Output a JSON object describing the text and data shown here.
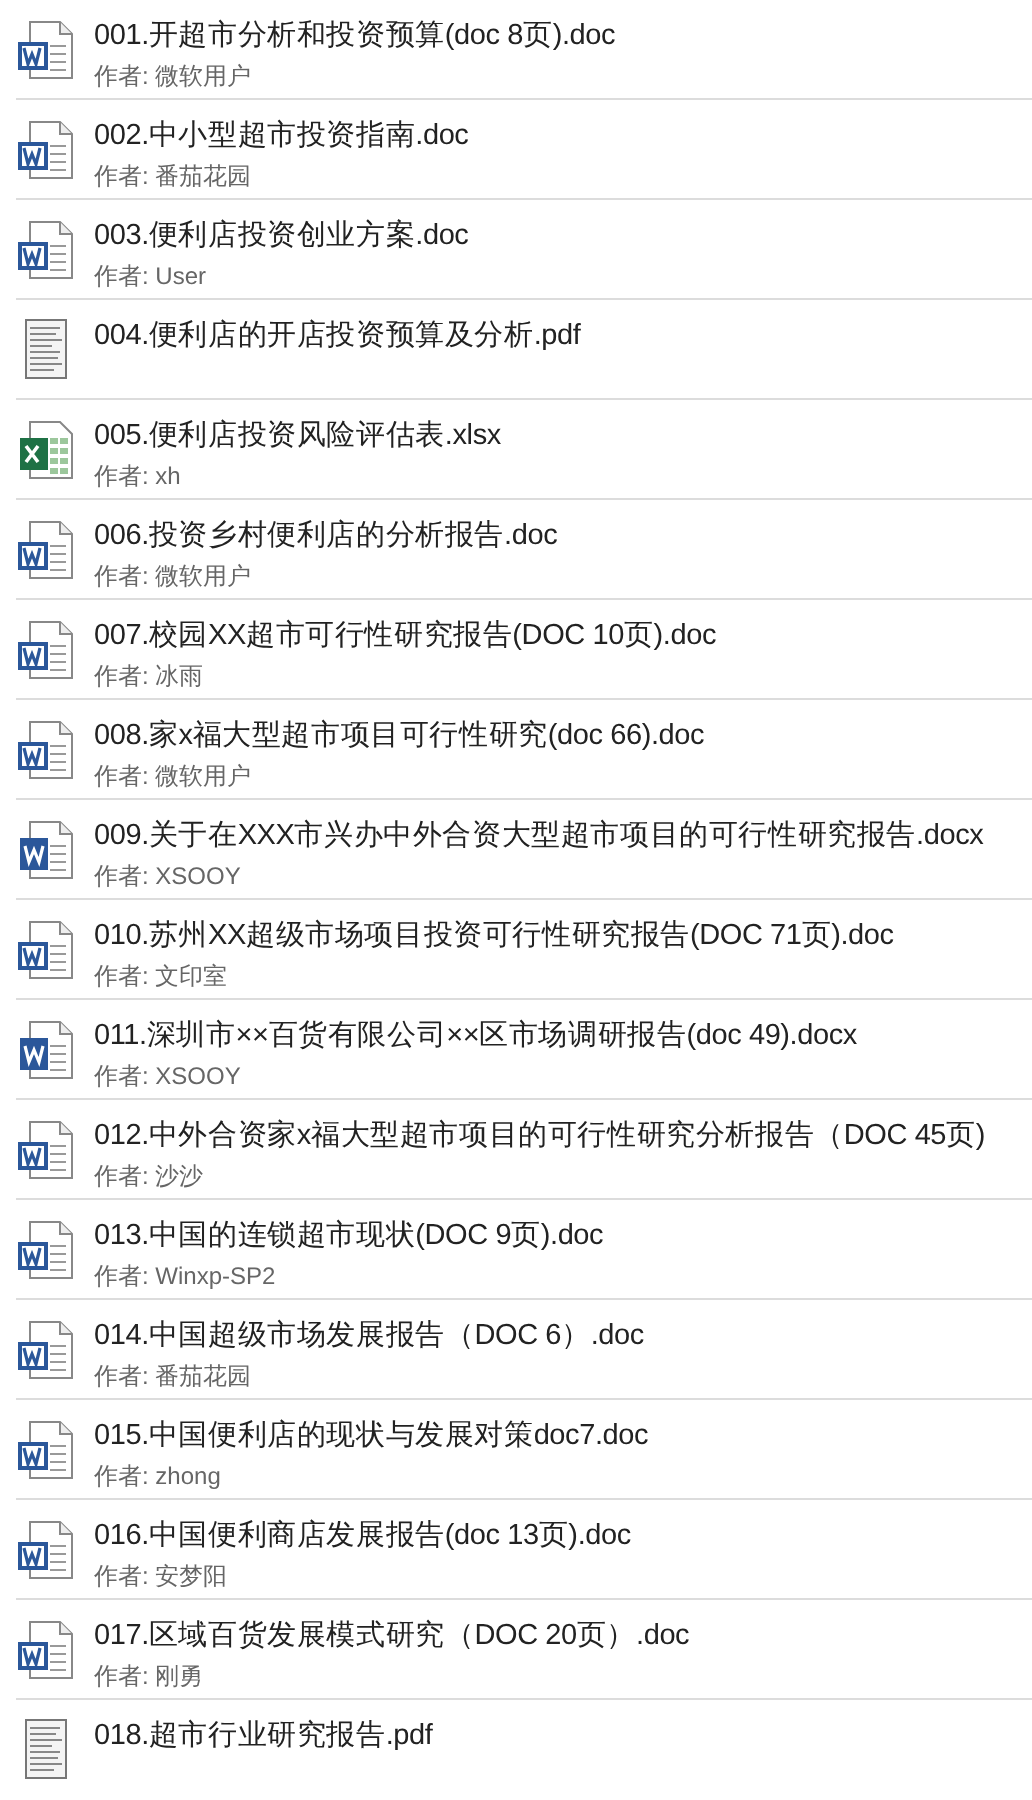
{
  "files": [
    {
      "kind": "doc",
      "title": "001.开超市分析和投资预算(doc 8页).doc",
      "author": "作者: 微软用户"
    },
    {
      "kind": "doc",
      "title": "002.中小型超市投资指南.doc",
      "author": "作者: 番茄花园"
    },
    {
      "kind": "doc",
      "title": "003.便利店投资创业方案.doc",
      "author": "作者: User"
    },
    {
      "kind": "pdf",
      "title": "004.便利店的开店投资预算及分析.pdf"
    },
    {
      "kind": "xlsx",
      "title": "005.便利店投资风险评估表.xlsx",
      "author": "作者: xh"
    },
    {
      "kind": "doc",
      "title": "006.投资乡村便利店的分析报告.doc",
      "author": "作者: 微软用户"
    },
    {
      "kind": "doc",
      "title": "007.校园XX超市可行性研究报告(DOC 10页).doc",
      "author": "作者: 冰雨"
    },
    {
      "kind": "doc",
      "title": "008.家x福大型超市项目可行性研究(doc 66).doc",
      "author": "作者: 微软用户"
    },
    {
      "kind": "docx",
      "title": "009.关于在XXX市兴办中外合资大型超市项目的可行性研究报告.docx",
      "author": "作者: XSOOY"
    },
    {
      "kind": "doc",
      "title": "010.苏州XX超级市场项目投资可行性研究报告(DOC 71页).doc",
      "author": "作者: 文印室"
    },
    {
      "kind": "docx",
      "title": "011.深圳市××百货有限公司××区市场调研报告(doc 49).docx",
      "author": "作者: XSOOY"
    },
    {
      "kind": "doc",
      "title": "012.中外合资家x福大型超市项目的可行性研究分析报告（DOC 45页)",
      "author": "作者: 沙沙"
    },
    {
      "kind": "doc",
      "title": "013.中国的连锁超市现状(DOC 9页).doc",
      "author": "作者: Winxp-SP2"
    },
    {
      "kind": "doc",
      "title": "014.中国超级市场发展报告（DOC 6）.doc",
      "author": "作者: 番茄花园"
    },
    {
      "kind": "doc",
      "title": "015.中国便利店的现状与发展对策doc7.doc",
      "author": "作者: zhong"
    },
    {
      "kind": "doc",
      "title": "016.中国便利商店发展报告(doc 13页).doc",
      "author": "作者: 安梦阳"
    },
    {
      "kind": "doc",
      "title": "017.区域百货发展模式研究（DOC 20页）.doc",
      "author": "作者: 刚勇"
    },
    {
      "kind": "pdf",
      "title": "018.超市行业研究报告.pdf"
    }
  ]
}
